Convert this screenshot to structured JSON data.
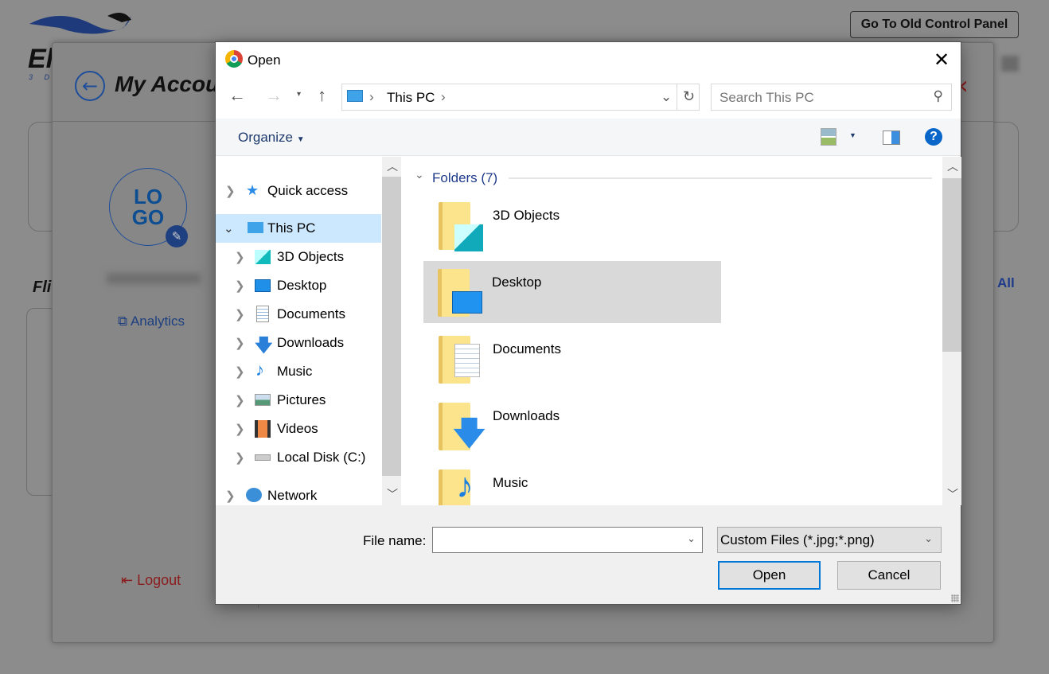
{
  "background": {
    "old_panel_button": "Go To Old Control Panel",
    "brand_sub": "3 D",
    "page_title": "My Account",
    "logo_text_top": "LO",
    "logo_text_bottom": "GO",
    "section_title": "Fli",
    "analytics_link": "Analytics",
    "logout_link": "Logout",
    "view_all_link": "All"
  },
  "dialog": {
    "title": "Open",
    "address_path": [
      "This PC"
    ],
    "search_placeholder": "Search This PC",
    "organize_label": "Organize",
    "nav_pane": [
      {
        "label": "Quick access",
        "icon": "star-icon",
        "expanded": false
      },
      {
        "label": "This PC",
        "icon": "computer-icon",
        "expanded": true,
        "selected": true
      },
      {
        "label": "3D Objects",
        "icon": "cube-icon"
      },
      {
        "label": "Desktop",
        "icon": "desktop-icon"
      },
      {
        "label": "Documents",
        "icon": "document-icon"
      },
      {
        "label": "Downloads",
        "icon": "download-icon"
      },
      {
        "label": "Music",
        "icon": "music-icon"
      },
      {
        "label": "Pictures",
        "icon": "picture-icon"
      },
      {
        "label": "Videos",
        "icon": "video-icon"
      },
      {
        "label": "Local Disk (C:)",
        "icon": "disk-icon"
      },
      {
        "label": "Network",
        "icon": "network-icon"
      }
    ],
    "group_header": "Folders (7)",
    "folders": [
      {
        "label": "3D Objects",
        "overlay": "cube"
      },
      {
        "label": "Desktop",
        "overlay": "desktop",
        "selected": true
      },
      {
        "label": "Documents",
        "overlay": "document"
      },
      {
        "label": "Downloads",
        "overlay": "download"
      },
      {
        "label": "Music",
        "overlay": "music"
      }
    ],
    "file_name_label": "File name:",
    "file_name_value": "",
    "file_type_selected": "Custom Files (*.jpg;*.png)",
    "open_button": "Open",
    "cancel_button": "Cancel"
  },
  "colors": {
    "accent": "#0078d7",
    "selection": "#cce8ff",
    "tile_selected": "#d9d9d9",
    "link_blue": "#1e3a8a",
    "logout_red": "#8b1c1c"
  }
}
